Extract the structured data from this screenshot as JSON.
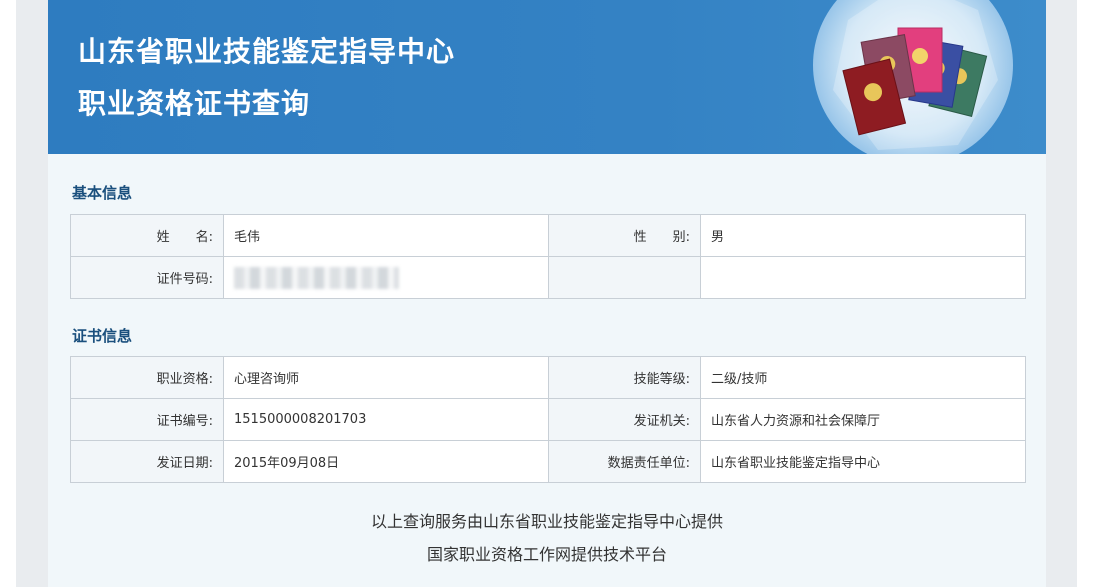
{
  "banner": {
    "title_line1": "山东省职业技能鉴定指导中心",
    "title_line2": "职业资格证书查询"
  },
  "basic_info": {
    "section_title": "基本信息",
    "name_label": "姓　　名:",
    "name_value": "毛伟",
    "gender_label": "性　　别:",
    "gender_value": "男",
    "id_label": "证件号码:"
  },
  "certificate_info": {
    "section_title": "证书信息",
    "rows": [
      {
        "label1": "职业资格:",
        "value1": "心理咨询师",
        "label2": "技能等级:",
        "value2": "二级/技师"
      },
      {
        "label1": "证书编号:",
        "value1": "1515000008201703",
        "label2": "发证机关:",
        "value2": "山东省人力资源和社会保障厅"
      },
      {
        "label1": "发证日期:",
        "value1": "2015年09月08日",
        "label2": "数据责任单位:",
        "value2": "山东省职业技能鉴定指导中心"
      }
    ]
  },
  "footer": {
    "line1": "以上查询服务由山东省职业技能鉴定指导中心提供",
    "line2": "国家职业资格工作网提供技术平台"
  }
}
